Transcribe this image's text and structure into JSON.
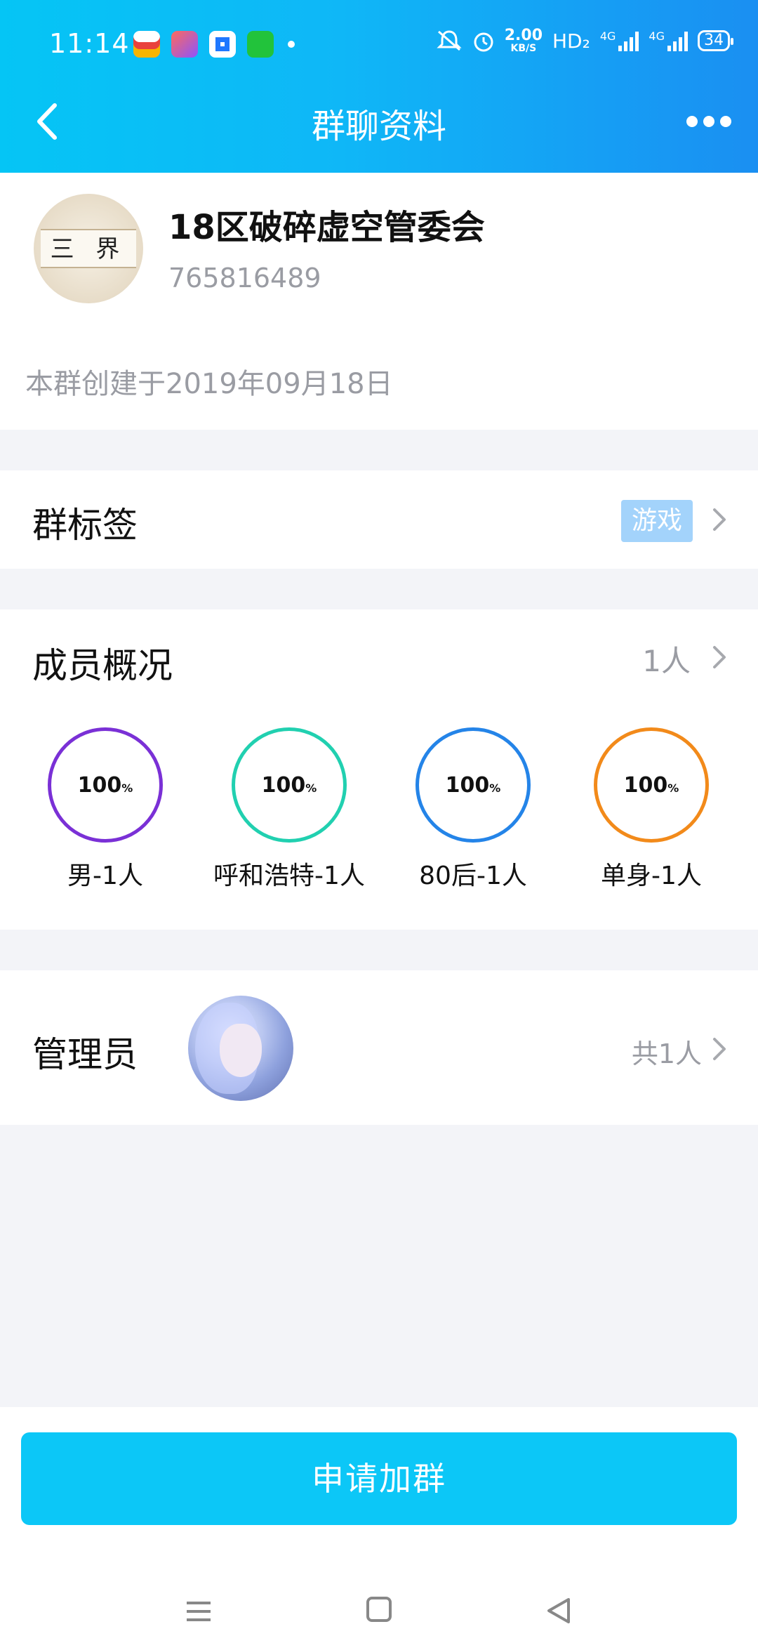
{
  "status_bar": {
    "time": "11:14",
    "net_speed_value": "2.00",
    "net_speed_unit": "KB/S",
    "hd_label": "HD₂",
    "network_1": "4G",
    "network_2": "4G",
    "battery": "34",
    "app_icons": [
      "tasks-app-icon",
      "pen-app-icon",
      "browser-app-icon",
      "iqiyi-app-icon"
    ]
  },
  "nav": {
    "title": "群聊资料",
    "back_icon": "chevron-left-icon",
    "more_icon": "more-dots-icon"
  },
  "group": {
    "avatar_text": "三 界",
    "name": "18区破碎虚空管委会",
    "id": "765816489",
    "created": "本群创建于2019年09月18日"
  },
  "tags": {
    "title": "群标签",
    "tag": "游戏"
  },
  "members": {
    "title": "成员概况",
    "count": "1人",
    "stats": [
      {
        "percent": "100",
        "unit": "%",
        "label": "男-1人",
        "color": "#7a30d6"
      },
      {
        "percent": "100",
        "unit": "%",
        "label": "呼和浩特-1人",
        "color": "#21d0b0"
      },
      {
        "percent": "100",
        "unit": "%",
        "label": "80后-1人",
        "color": "#2484e8"
      },
      {
        "percent": "100",
        "unit": "%",
        "label": "单身-1人",
        "color": "#f28a1a"
      }
    ]
  },
  "admins": {
    "title": "管理员",
    "total": "共1人"
  },
  "actions": {
    "apply": "申请加群"
  },
  "colors": {
    "accent": "#0cc7f7",
    "header_start": "#05c5f5",
    "header_end": "#1a8ff2",
    "muted_text": "#9a9ca3",
    "tag_bg": "#a3d3fb"
  }
}
